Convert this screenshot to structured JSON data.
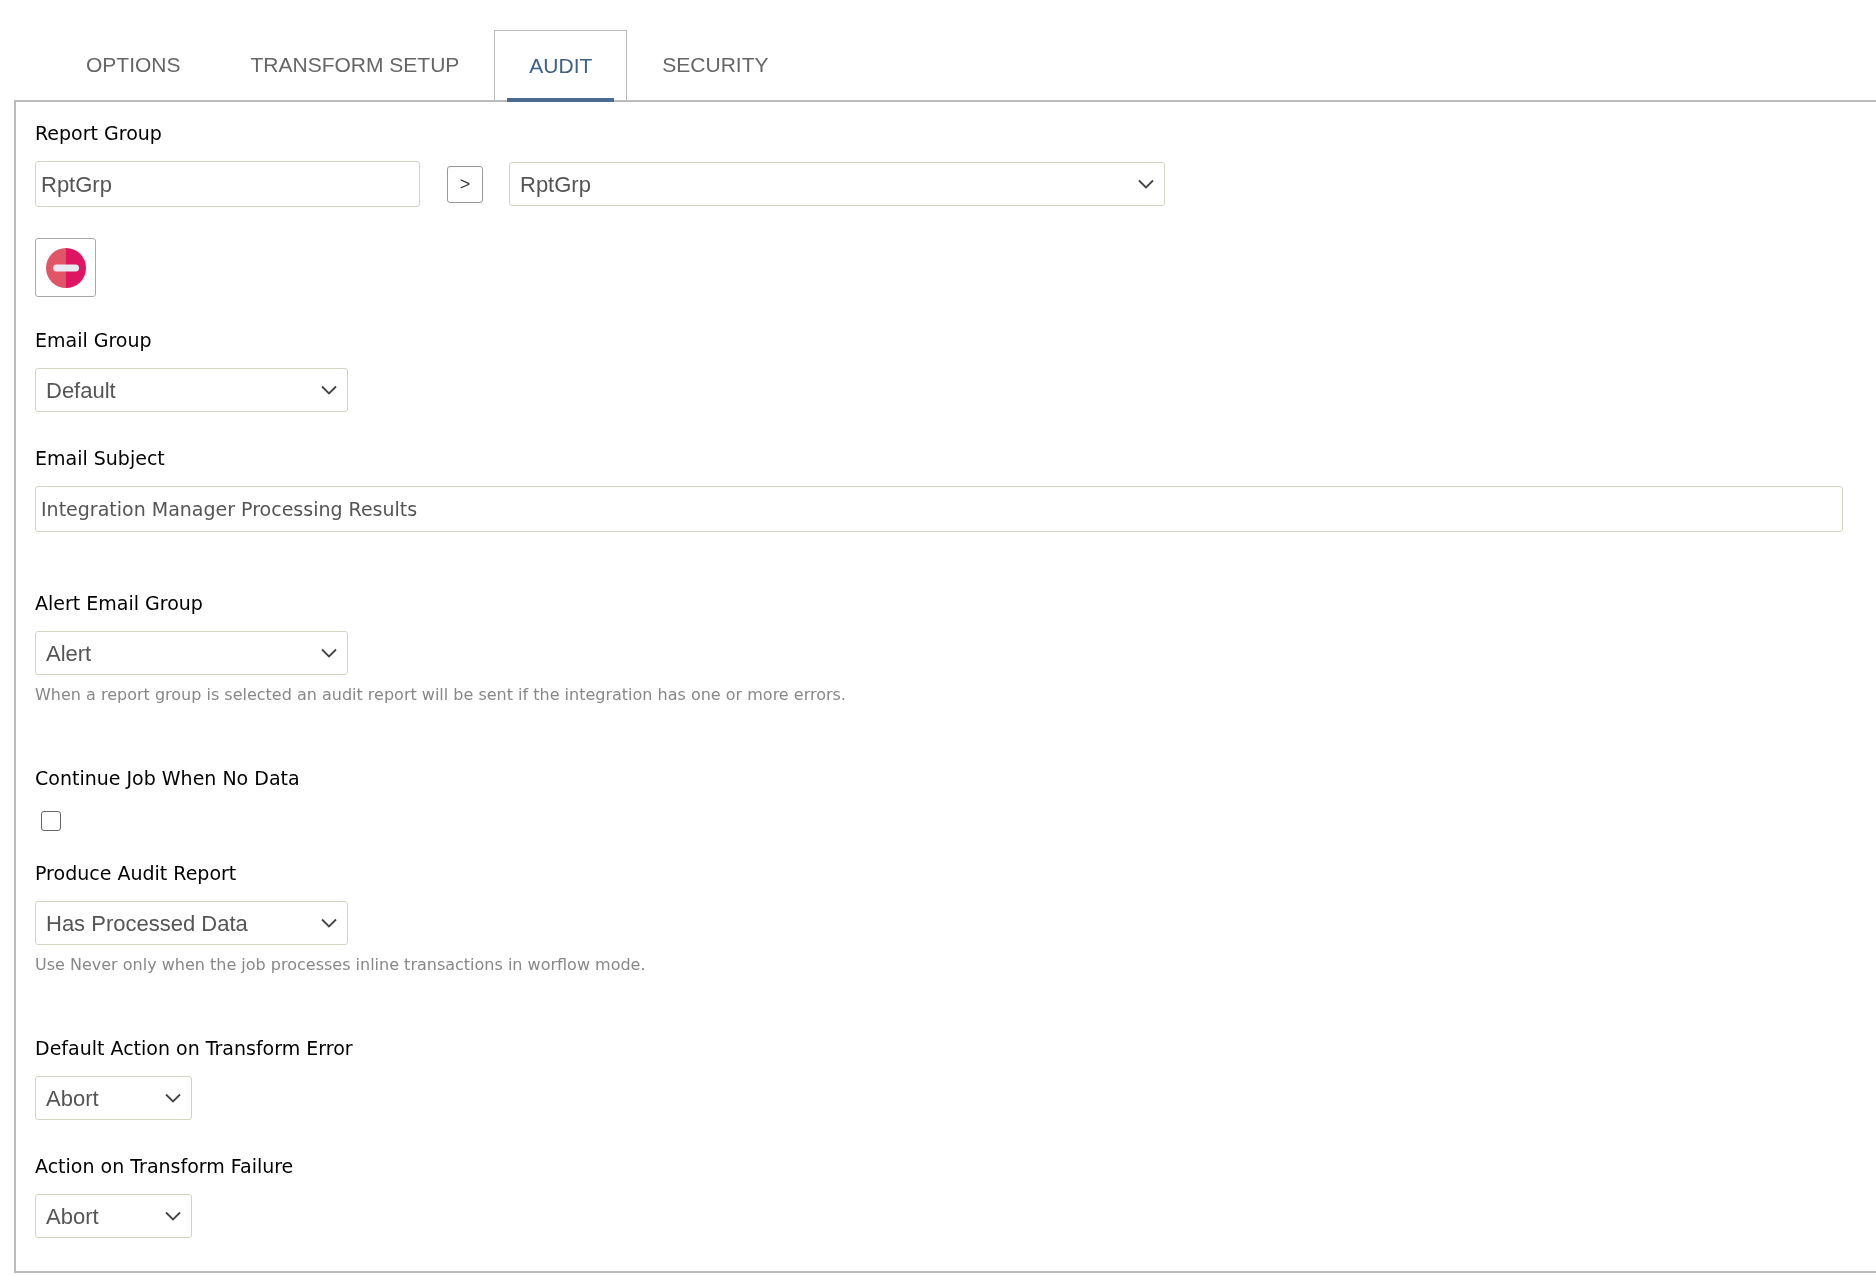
{
  "tabs": [
    {
      "label": "OPTIONS",
      "selected": false
    },
    {
      "label": "TRANSFORM SETUP",
      "selected": false
    },
    {
      "label": "AUDIT",
      "selected": true
    },
    {
      "label": "SECURITY",
      "selected": false
    }
  ],
  "fields": [
    {
      "kind": "transfer",
      "label": "Report Group",
      "input_value": "RptGrp",
      "button": ">",
      "select_value": "RptGrp"
    },
    {
      "kind": "select",
      "label": "Email Group",
      "value": "Default"
    },
    {
      "kind": "text",
      "label": "Email Subject",
      "value": "Integration Manager Processing Results"
    },
    {
      "kind": "select",
      "label": "Alert Email Group",
      "value": "Alert",
      "hint": "When a report group is selected an audit report will be sent if the integration has one or more errors."
    },
    {
      "kind": "checkbox",
      "label": "Continue Job When No Data",
      "checked": false
    },
    {
      "kind": "select",
      "label": "Produce Audit Report",
      "value": "Has Processed Data",
      "hint": "Use Never only when the job processes inline transactions in worflow mode."
    },
    {
      "kind": "short_select",
      "label": "Default Action on Transform Error",
      "value": "Abort"
    },
    {
      "kind": "short_select",
      "label": "Action on Transform Failure",
      "value": "Abort"
    }
  ]
}
